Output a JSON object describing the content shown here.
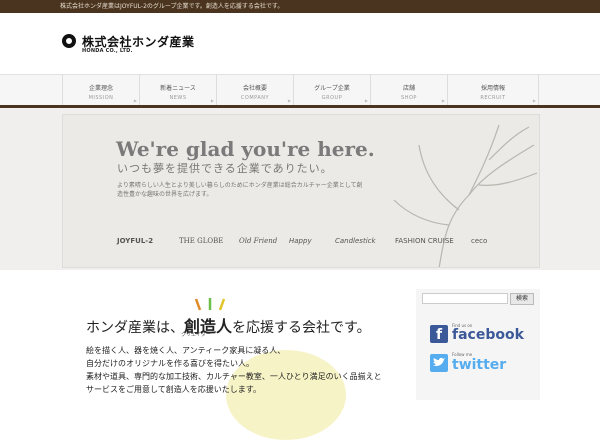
{
  "topbar": {
    "text": "株式会社ホンダ産業はJOYFUL-2のグループ企業です。創造人を応援する会社です。"
  },
  "logo": {
    "name": "株式会社ホンダ産業",
    "sub": "HONDA CO., LTD."
  },
  "nav": [
    {
      "jp": "企業理念",
      "en": "MISSION"
    },
    {
      "jp": "新着ニュース",
      "en": "NEWS"
    },
    {
      "jp": "会社概要",
      "en": "COMPANY"
    },
    {
      "jp": "グループ企業",
      "en": "GROUP"
    },
    {
      "jp": "店舗",
      "en": "SHOP"
    },
    {
      "jp": "採用情報",
      "en": "RECRUIT"
    }
  ],
  "hero": {
    "title": "We're glad you're here.",
    "subtitle": "いつも夢を提供できる企業でありたい。",
    "desc": "より素晴らしい人生とより美しい暮らしのためにホンダ産業は総合カルチャー企業として創造性豊かな趣味の世界を広げます。",
    "brands": [
      "JOYFUL-2",
      "THE GLOBE",
      "Old Friend",
      "Happy",
      "Candlestick",
      "FASHION CRUISE",
      "ceco"
    ]
  },
  "main": {
    "title_prefix": "ホンダ産業は、",
    "title_emph": "創造人",
    "title_suffix": "を応援する会社です。",
    "ruby": "クリエイター",
    "lines": [
      "絵を描く人、器を焼く人、アンティーク家具に凝る人、",
      "自分だけのオリジナルを作る喜びを得たい人。",
      "素材や道具、専門的な加工技術、カルチャー教室、一人ひとり満足のいく品揃えと",
      "サービスをご用意して創造人を応援いたします。"
    ]
  },
  "sidebar": {
    "search_placeholder": "",
    "search_button": "検索",
    "facebook_small": "Find us on",
    "facebook": "facebook",
    "twitter_small": "Follow me",
    "twitter": "twitter"
  },
  "colors": {
    "brown": "#4a3420",
    "facebook": "#3b5998",
    "twitter": "#55acee"
  }
}
